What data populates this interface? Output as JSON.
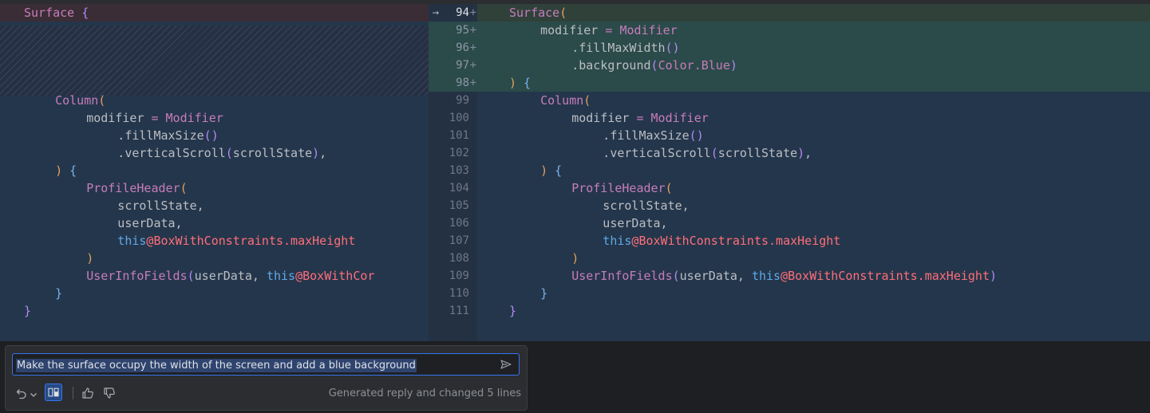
{
  "diff": {
    "left_lines": [
      {
        "indent": 1,
        "segments": [
          {
            "t": "Surface ",
            "c": "ty"
          },
          {
            "t": "{",
            "c": "p2"
          }
        ]
      },
      {
        "indent": 2,
        "segments": [
          {
            "t": "Column",
            "c": "fn"
          },
          {
            "t": "(",
            "c": "p1"
          }
        ]
      },
      {
        "indent": 3,
        "segments": [
          {
            "t": "modifier ",
            "c": "k"
          },
          {
            "t": "= ",
            "c": "op"
          },
          {
            "t": "Modifier",
            "c": "ty"
          }
        ]
      },
      {
        "indent": 4,
        "segments": [
          {
            "t": ".fillMaxSize",
            "c": "k"
          },
          {
            "t": "()",
            "c": "p2"
          }
        ]
      },
      {
        "indent": 4,
        "segments": [
          {
            "t": ".verticalScroll",
            "c": "k"
          },
          {
            "t": "(",
            "c": "p2"
          },
          {
            "t": "scrollState",
            "c": "k"
          },
          {
            "t": ")",
            "c": "p2"
          },
          {
            "t": ",",
            "c": "k"
          }
        ]
      },
      {
        "indent": 2,
        "segments": [
          {
            "t": ")",
            "c": "p1"
          },
          {
            "t": " {",
            "c": "cl"
          }
        ]
      },
      {
        "indent": 3,
        "segments": [
          {
            "t": "ProfileHeader",
            "c": "fn"
          },
          {
            "t": "(",
            "c": "p1"
          }
        ]
      },
      {
        "indent": 4,
        "segments": [
          {
            "t": "scrollState,",
            "c": "k"
          }
        ]
      },
      {
        "indent": 4,
        "segments": [
          {
            "t": "userData,",
            "c": "k"
          }
        ]
      },
      {
        "indent": 4,
        "segments": [
          {
            "t": "this",
            "c": "kw"
          },
          {
            "t": "@BoxWithConstraints.maxHeight",
            "c": "an"
          }
        ]
      },
      {
        "indent": 3,
        "segments": [
          {
            "t": ")",
            "c": "p1"
          }
        ]
      },
      {
        "indent": 3,
        "segments": [
          {
            "t": "UserInfoFields",
            "c": "fn"
          },
          {
            "t": "(",
            "c": "p2"
          },
          {
            "t": "userData, ",
            "c": "k"
          },
          {
            "t": "this",
            "c": "kw"
          },
          {
            "t": "@BoxWithCor",
            "c": "an"
          }
        ]
      },
      {
        "indent": 2,
        "segments": [
          {
            "t": "}",
            "c": "cl"
          }
        ]
      },
      {
        "indent": 1,
        "segments": [
          {
            "t": "}",
            "c": "p2"
          }
        ]
      }
    ],
    "gutter_numbers": [
      "94",
      "95",
      "96",
      "97",
      "98",
      "99",
      "100",
      "101",
      "102",
      "103",
      "104",
      "105",
      "106",
      "107",
      "108",
      "109",
      "110",
      "111"
    ],
    "added_marker": "+",
    "arrow": "→",
    "right_lines": [
      {
        "indent": 1,
        "segments": [
          {
            "t": "Surface",
            "c": "ty"
          },
          {
            "t": "(",
            "c": "p1"
          }
        ]
      },
      {
        "indent": 2,
        "segments": [
          {
            "t": "modifier ",
            "c": "k"
          },
          {
            "t": "= ",
            "c": "op"
          },
          {
            "t": "Modifier",
            "c": "ty"
          }
        ]
      },
      {
        "indent": 3,
        "segments": [
          {
            "t": ".fillMaxWidth",
            "c": "k"
          },
          {
            "t": "()",
            "c": "p2"
          }
        ]
      },
      {
        "indent": 3,
        "segments": [
          {
            "t": ".background",
            "c": "k"
          },
          {
            "t": "(",
            "c": "p2"
          },
          {
            "t": "Color.Blue",
            "c": "ty"
          },
          {
            "t": ")",
            "c": "p2"
          }
        ]
      },
      {
        "indent": 1,
        "segments": [
          {
            "t": ")",
            "c": "p1"
          },
          {
            "t": " {",
            "c": "cl"
          }
        ]
      },
      {
        "indent": 2,
        "segments": [
          {
            "t": "Column",
            "c": "fn"
          },
          {
            "t": "(",
            "c": "p1"
          }
        ]
      },
      {
        "indent": 3,
        "segments": [
          {
            "t": "modifier ",
            "c": "k"
          },
          {
            "t": "= ",
            "c": "op"
          },
          {
            "t": "Modifier",
            "c": "ty"
          }
        ]
      },
      {
        "indent": 4,
        "segments": [
          {
            "t": ".fillMaxSize",
            "c": "k"
          },
          {
            "t": "()",
            "c": "p2"
          }
        ]
      },
      {
        "indent": 4,
        "segments": [
          {
            "t": ".verticalScroll",
            "c": "k"
          },
          {
            "t": "(",
            "c": "p2"
          },
          {
            "t": "scrollState",
            "c": "k"
          },
          {
            "t": ")",
            "c": "p2"
          },
          {
            "t": ",",
            "c": "k"
          }
        ]
      },
      {
        "indent": 2,
        "segments": [
          {
            "t": ")",
            "c": "p1"
          },
          {
            "t": " {",
            "c": "cl"
          }
        ]
      },
      {
        "indent": 3,
        "segments": [
          {
            "t": "ProfileHeader",
            "c": "fn"
          },
          {
            "t": "(",
            "c": "p1"
          }
        ]
      },
      {
        "indent": 4,
        "segments": [
          {
            "t": "scrollState,",
            "c": "k"
          }
        ]
      },
      {
        "indent": 4,
        "segments": [
          {
            "t": "userData,",
            "c": "k"
          }
        ]
      },
      {
        "indent": 4,
        "segments": [
          {
            "t": "this",
            "c": "kw"
          },
          {
            "t": "@BoxWithConstraints.maxHeight",
            "c": "an"
          }
        ]
      },
      {
        "indent": 3,
        "segments": [
          {
            "t": ")",
            "c": "p1"
          }
        ]
      },
      {
        "indent": 3,
        "segments": [
          {
            "t": "UserInfoFields",
            "c": "fn"
          },
          {
            "t": "(",
            "c": "p2"
          },
          {
            "t": "userData, ",
            "c": "k"
          },
          {
            "t": "this",
            "c": "kw"
          },
          {
            "t": "@BoxWithConstraints.maxHeight",
            "c": "an"
          },
          {
            "t": ")",
            "c": "p2"
          }
        ]
      },
      {
        "indent": 2,
        "segments": [
          {
            "t": "}",
            "c": "cl"
          }
        ]
      },
      {
        "indent": 1,
        "segments": [
          {
            "t": "}",
            "c": "p2"
          }
        ]
      }
    ]
  },
  "prompt": {
    "input_value": "Make the surface occupy the width of the screen and add a blue background",
    "status_text": "Generated reply and changed 5 lines"
  },
  "icons": {
    "send": "send-icon",
    "undo": "undo-icon",
    "dropdown": "chevron-down-icon",
    "diff": "diff-view-icon",
    "thumbs_up": "thumbs-up-icon",
    "thumbs_down": "thumbs-down-icon"
  },
  "colors": {
    "accent": "#3574f0",
    "added_bg": "#2b4a4a",
    "removed_bg": "#3a2d36",
    "editor_bg": "#24364b"
  }
}
